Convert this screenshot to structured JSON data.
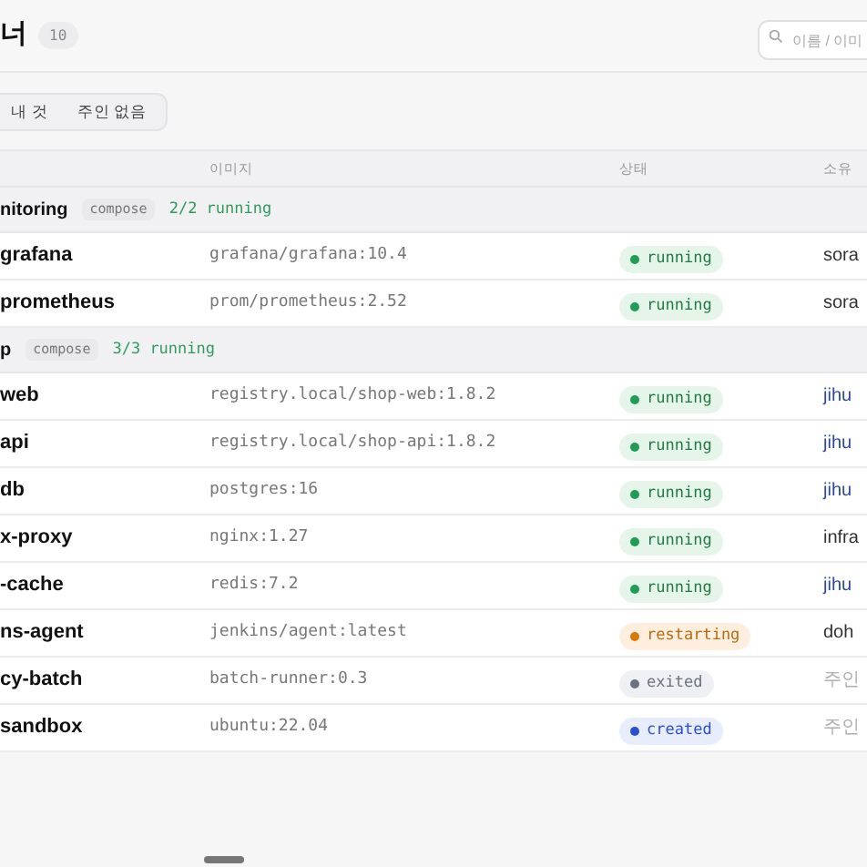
{
  "header": {
    "title": "너",
    "count": "10",
    "search": {
      "placeholder": "이름 / 이미"
    }
  },
  "filters": [
    {
      "label": "내 것",
      "selected": false
    },
    {
      "label": "주인 없음",
      "selected": false
    }
  ],
  "table": {
    "columns": [
      "이미지",
      "상태",
      "소유"
    ],
    "groups": [
      {
        "name": "nitoring",
        "tag": "compose",
        "summary": "2/2 running",
        "rows": [
          {
            "name": "grafana",
            "image": "grafana/grafana:10.4",
            "status": "running",
            "color": "#1f9d55",
            "owner": "sora",
            "kind": "other"
          },
          {
            "name": "prometheus",
            "image": "prom/prometheus:2.52",
            "status": "running",
            "color": "#1f9d55",
            "owner": "sora",
            "kind": "other"
          }
        ]
      },
      {
        "name": "p",
        "tag": "compose",
        "summary": "3/3 running",
        "rows": [
          {
            "name": "web",
            "image": "registry.local/shop-web:1.8.2",
            "status": "running",
            "color": "#1f9d55",
            "owner": "jihu",
            "kind": "me"
          },
          {
            "name": "api",
            "image": "registry.local/shop-api:1.8.2",
            "status": "running",
            "color": "#1f9d55",
            "owner": "jihu",
            "kind": "me"
          },
          {
            "name": "db",
            "image": "postgres:16",
            "status": "running",
            "color": "#1f9d55",
            "owner": "jihu",
            "kind": "me"
          }
        ]
      },
      {
        "rows": [
          {
            "name": "x-proxy",
            "image": "nginx:1.27",
            "status": "running",
            "color": "#1f9d55",
            "owner": "infra",
            "kind": "other"
          },
          {
            "name": "-cache",
            "image": "redis:7.2",
            "status": "running",
            "color": "#1f9d55",
            "owner": "jihu",
            "kind": "me"
          },
          {
            "name": "ns-agent",
            "image": "jenkins/agent:latest",
            "status": "restarting",
            "color": "#d97706",
            "owner": "doh",
            "kind": "other"
          },
          {
            "name": "cy-batch",
            "image": "batch-runner:0.3",
            "status": "exited",
            "color": "#6b7280",
            "owner": "주인",
            "kind": "none"
          },
          {
            "name": "sandbox",
            "image": "ubuntu:22.04",
            "status": "created",
            "color": "#2b4fd1",
            "owner": "주인",
            "kind": "none"
          }
        ]
      }
    ]
  }
}
